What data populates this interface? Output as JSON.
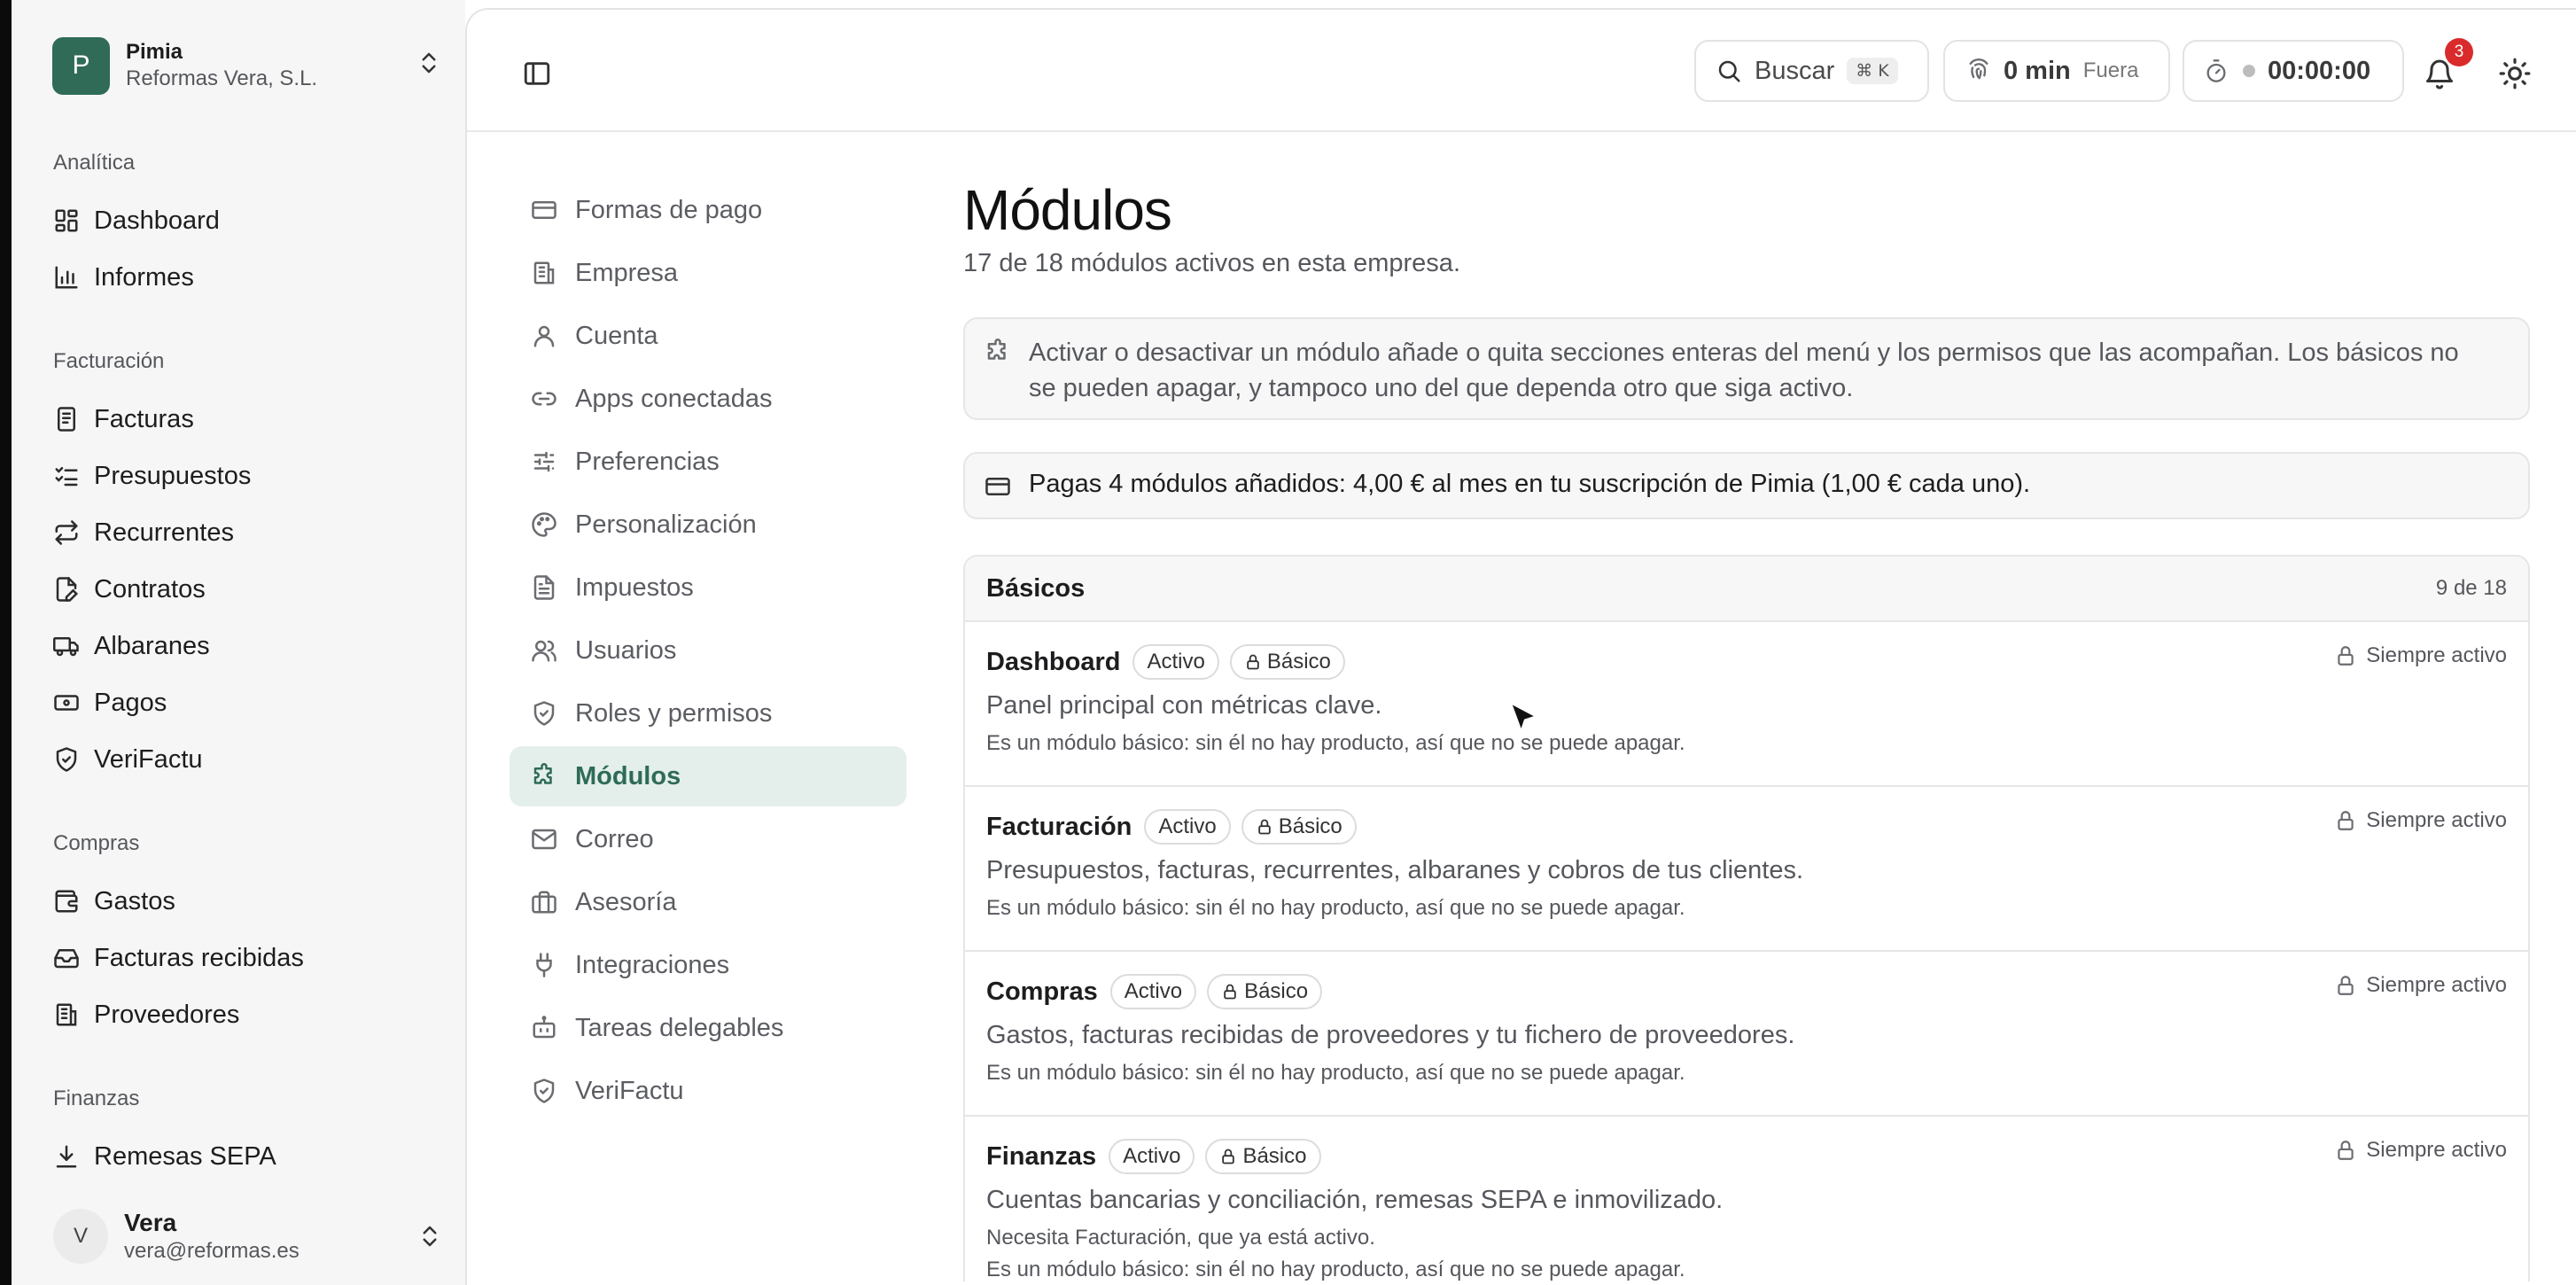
{
  "sidebar": {
    "brand": {
      "initial": "P",
      "name": "Pimia",
      "company": "Reformas Vera, S.L."
    },
    "groups": [
      {
        "title": "Analítica",
        "items": [
          {
            "label": "Dashboard",
            "icon": "dashboard-icon"
          },
          {
            "label": "Informes",
            "icon": "bar-chart-icon"
          }
        ]
      },
      {
        "title": "Facturación",
        "items": [
          {
            "label": "Facturas",
            "icon": "invoice-icon"
          },
          {
            "label": "Presupuestos",
            "icon": "checklist-icon"
          },
          {
            "label": "Recurrentes",
            "icon": "repeat-icon"
          },
          {
            "label": "Contratos",
            "icon": "contract-icon"
          },
          {
            "label": "Albaranes",
            "icon": "truck-icon"
          },
          {
            "label": "Pagos",
            "icon": "banknote-icon"
          },
          {
            "label": "VeriFactu",
            "icon": "shield-check-icon"
          }
        ]
      },
      {
        "title": "Compras",
        "items": [
          {
            "label": "Gastos",
            "icon": "wallet-icon"
          },
          {
            "label": "Facturas recibidas",
            "icon": "inbox-icon"
          },
          {
            "label": "Proveedores",
            "icon": "building-icon"
          }
        ]
      },
      {
        "title": "Finanzas",
        "items": [
          {
            "label": "Remesas SEPA",
            "icon": "download-icon"
          }
        ]
      }
    ],
    "user": {
      "initial": "V",
      "name": "Vera",
      "email": "vera@reformas.es"
    }
  },
  "topbar": {
    "search_label": "Buscar",
    "search_shortcut": "⌘ K",
    "time_value": "0 min",
    "time_status": "Fuera",
    "timer_value": "00:00:00",
    "notifications_count": "3"
  },
  "settings_nav": [
    {
      "label": "Formas de pago",
      "icon": "credit-card-icon"
    },
    {
      "label": "Empresa",
      "icon": "building-icon"
    },
    {
      "label": "Cuenta",
      "icon": "user-icon"
    },
    {
      "label": "Apps conectadas",
      "icon": "link-icon"
    },
    {
      "label": "Preferencias",
      "icon": "sliders-icon"
    },
    {
      "label": "Personalización",
      "icon": "palette-icon"
    },
    {
      "label": "Impuestos",
      "icon": "document-icon"
    },
    {
      "label": "Usuarios",
      "icon": "users-icon"
    },
    {
      "label": "Roles y permisos",
      "icon": "shield-check-icon"
    },
    {
      "label": "Módulos",
      "icon": "puzzle-icon",
      "active": true
    },
    {
      "label": "Correo",
      "icon": "mail-icon"
    },
    {
      "label": "Asesoría",
      "icon": "briefcase-icon"
    },
    {
      "label": "Integraciones",
      "icon": "plug-icon"
    },
    {
      "label": "Tareas delegables",
      "icon": "bot-icon"
    },
    {
      "label": "VeriFactu",
      "icon": "shield-check-icon"
    }
  ],
  "content": {
    "title": "Módulos",
    "subtitle": "17 de 18 módulos activos en esta empresa.",
    "info_line1": "Activar o desactivar un módulo añade o quita secciones enteras del menú y los permisos que las acompañan. Los básicos no",
    "info_line2": "se pueden apagar, y tampoco uno del que dependa otro que siga activo.",
    "payment_text": "Pagas 4 módulos añadidos: 4,00 € al mes en tu suscripción de Pimia (1,00 € cada uno).",
    "section_title": "Básicos",
    "section_count": "9 de 18",
    "modules": [
      {
        "name": "Dashboard",
        "status": "Activo",
        "tier": "Básico",
        "description": "Panel principal con métricas clave.",
        "note": "Es un módulo básico: sin él no hay producto, así que no se puede apagar.",
        "always": "Siempre activo"
      },
      {
        "name": "Facturación",
        "status": "Activo",
        "tier": "Básico",
        "description": "Presupuestos, facturas, recurrentes, albaranes y cobros de tus clientes.",
        "note": "Es un módulo básico: sin él no hay producto, así que no se puede apagar.",
        "always": "Siempre activo"
      },
      {
        "name": "Compras",
        "status": "Activo",
        "tier": "Básico",
        "description": "Gastos, facturas recibidas de proveedores y tu fichero de proveedores.",
        "note": "Es un módulo básico: sin él no hay producto, así que no se puede apagar.",
        "always": "Siempre activo"
      },
      {
        "name": "Finanzas",
        "status": "Activo",
        "tier": "Básico",
        "description": "Cuentas bancarias y conciliación, remesas SEPA e inmovilizado.",
        "note": "Necesita Facturación, que ya está activo.",
        "note2": "Es un módulo básico: sin él no hay producto, así que no se puede apagar.",
        "always": "Siempre activo"
      }
    ]
  },
  "colors": {
    "brand": "#2f6b57",
    "active_bg": "#e4efeb",
    "badge_red": "#d92b2b"
  }
}
